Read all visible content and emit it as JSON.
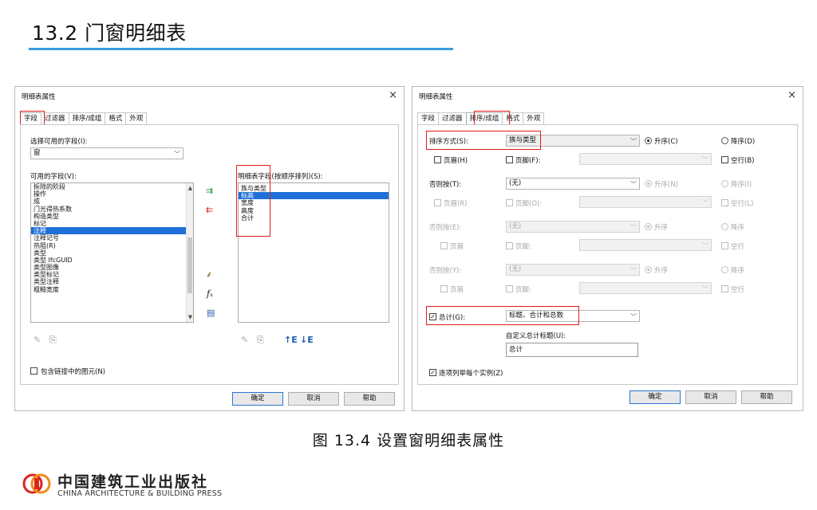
{
  "slide": {
    "title": "13.2  门窗明细表",
    "caption": "图 13.4   设置窗明细表属性"
  },
  "colors": {
    "accent_rule": "#3b9bd8",
    "highlight_box": "#e21b1b",
    "list_selection": "#1e70d8"
  },
  "dialog_fields": {
    "title": "明细表属性",
    "close": "×",
    "tabs": [
      "字段",
      "过滤器",
      "排序/成组",
      "格式",
      "外观"
    ],
    "select_available_label": "选择可用的字段(I):",
    "select_available_value": "窗",
    "available_label": "可用的字段(V):",
    "available_items": [
      "拆除的阶段",
      "操作",
      "成",
      "门光得热系数",
      "构造类型",
      "标记",
      "注释",
      "注释记号",
      "热阻(R)",
      "类型",
      "类型 IfcGUID",
      "类型图像",
      "类型标记",
      "类型注释",
      "粗糙宽度"
    ],
    "available_selected_index": 6,
    "scheduled_label": "明细表字段(按顺序排列)(S):",
    "scheduled_items": [
      "族与类型",
      "标高",
      "宽度",
      "高度",
      "合计"
    ],
    "scheduled_selected_index": 1,
    "include_linked": "包含链接中的图元(N)",
    "icons": {
      "add": "add-field-icon",
      "remove": "remove-field-icon",
      "add_param": "add-parameter-icon",
      "calc": "calculated-value-icon",
      "combine": "combine-parameters-icon",
      "edit": "edit-field-icon",
      "delete": "delete-field-icon",
      "move_up": "move-up-icon",
      "move_down": "move-down-icon"
    }
  },
  "dialog_sort": {
    "title": "明细表属性",
    "close": "×",
    "tabs": [
      "字段",
      "过滤器",
      "排序/成组",
      "格式",
      "外观"
    ],
    "sort_by_label": "排序方式(S):",
    "sort_by_value": "族与类型",
    "ascending": "升序(C)",
    "descending": "降序(D)",
    "header": "页眉(H)",
    "footer": "页脚(F):",
    "blank_line": "空行(B)",
    "then_by_label": "否则按(T):",
    "then_by_value": "(无)",
    "ascending_n": "升序(N)",
    "descending_i": "降序(I)",
    "header_r": "页眉(R)",
    "footer_o": "页脚(O):",
    "blank_l": "空行(L)",
    "then_by_e_label": "否则按(E):",
    "then_by_y_label": "否则按(Y):",
    "none": "(无)",
    "asc": "升序",
    "desc": "降序",
    "hdr": "页眉",
    "ftr": "页脚:",
    "blank": "空行",
    "grand_total_label": "总计(G):",
    "grand_total_value": "标题、合计和总数",
    "custom_title_label": "自定义总计标题(U):",
    "custom_title_value": "总计",
    "itemize": "逐项列举每个实例(Z)"
  },
  "buttons": {
    "ok": "确定",
    "cancel": "取消",
    "help": "帮助"
  },
  "publisher": {
    "cn": "中国建筑工业出版社",
    "en": "CHINA ARCHITECTURE & BUILDING PRESS"
  }
}
